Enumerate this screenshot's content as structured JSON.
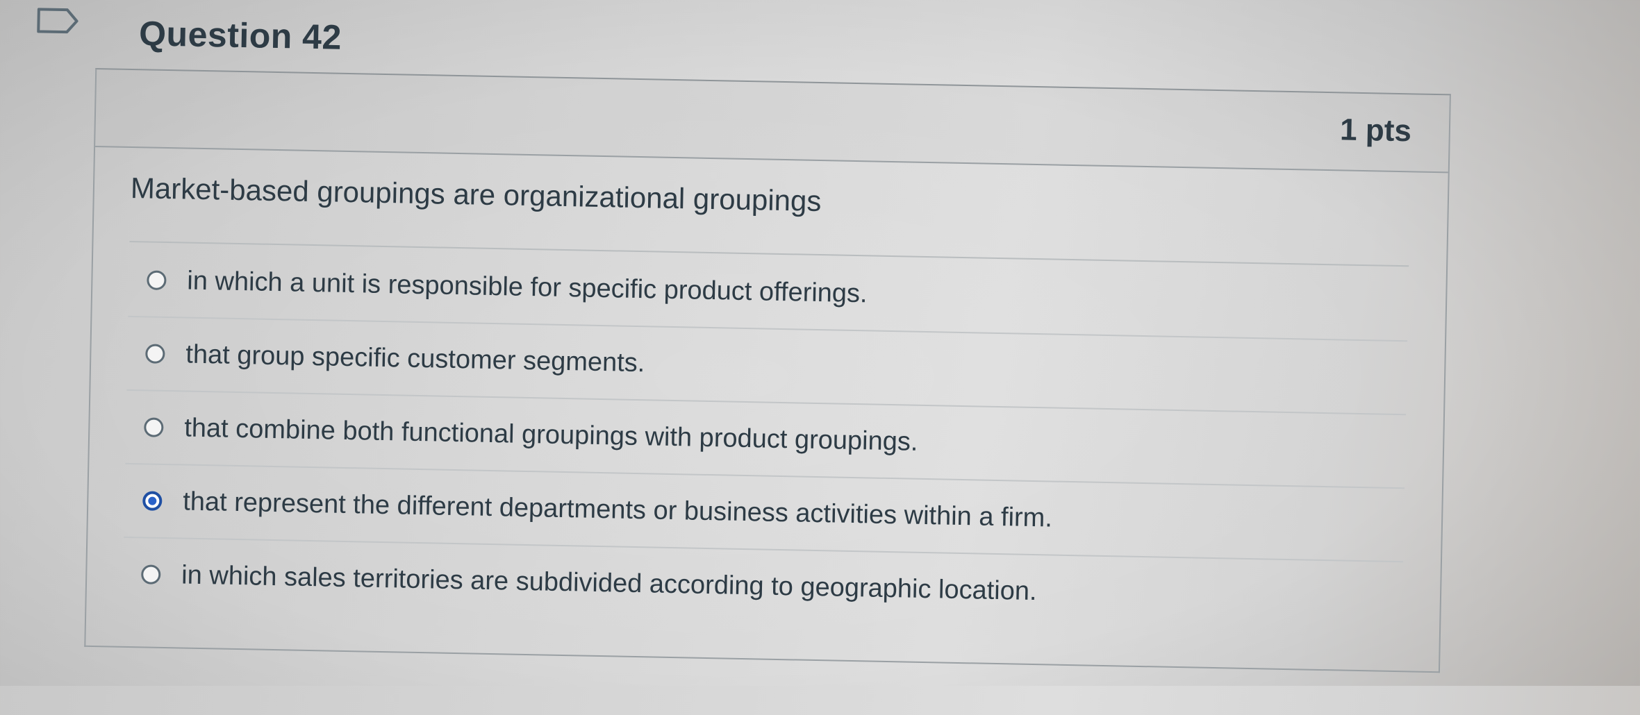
{
  "question": {
    "title": "Question 42",
    "points": "1 pts",
    "text": "Market-based groupings are organizational groupings",
    "answers": [
      {
        "label": "in which a unit is responsible for specific product offerings.",
        "selected": false
      },
      {
        "label": "that group specific customer segments.",
        "selected": false
      },
      {
        "label": "that combine both functional groupings with product groupings.",
        "selected": false
      },
      {
        "label": "that represent the different departments or business activities within a firm.",
        "selected": true
      },
      {
        "label": "in which sales territories are subdivided according to geographic location.",
        "selected": false
      }
    ]
  },
  "icons": {
    "flag": "bookmark-flag-icon",
    "radio_unchecked": "radio-unchecked-icon",
    "radio_checked": "radio-checked-icon"
  },
  "colors": {
    "text": "#2d3b45",
    "border": "#9aa0a4",
    "radio_selected": "#2a62c9"
  }
}
